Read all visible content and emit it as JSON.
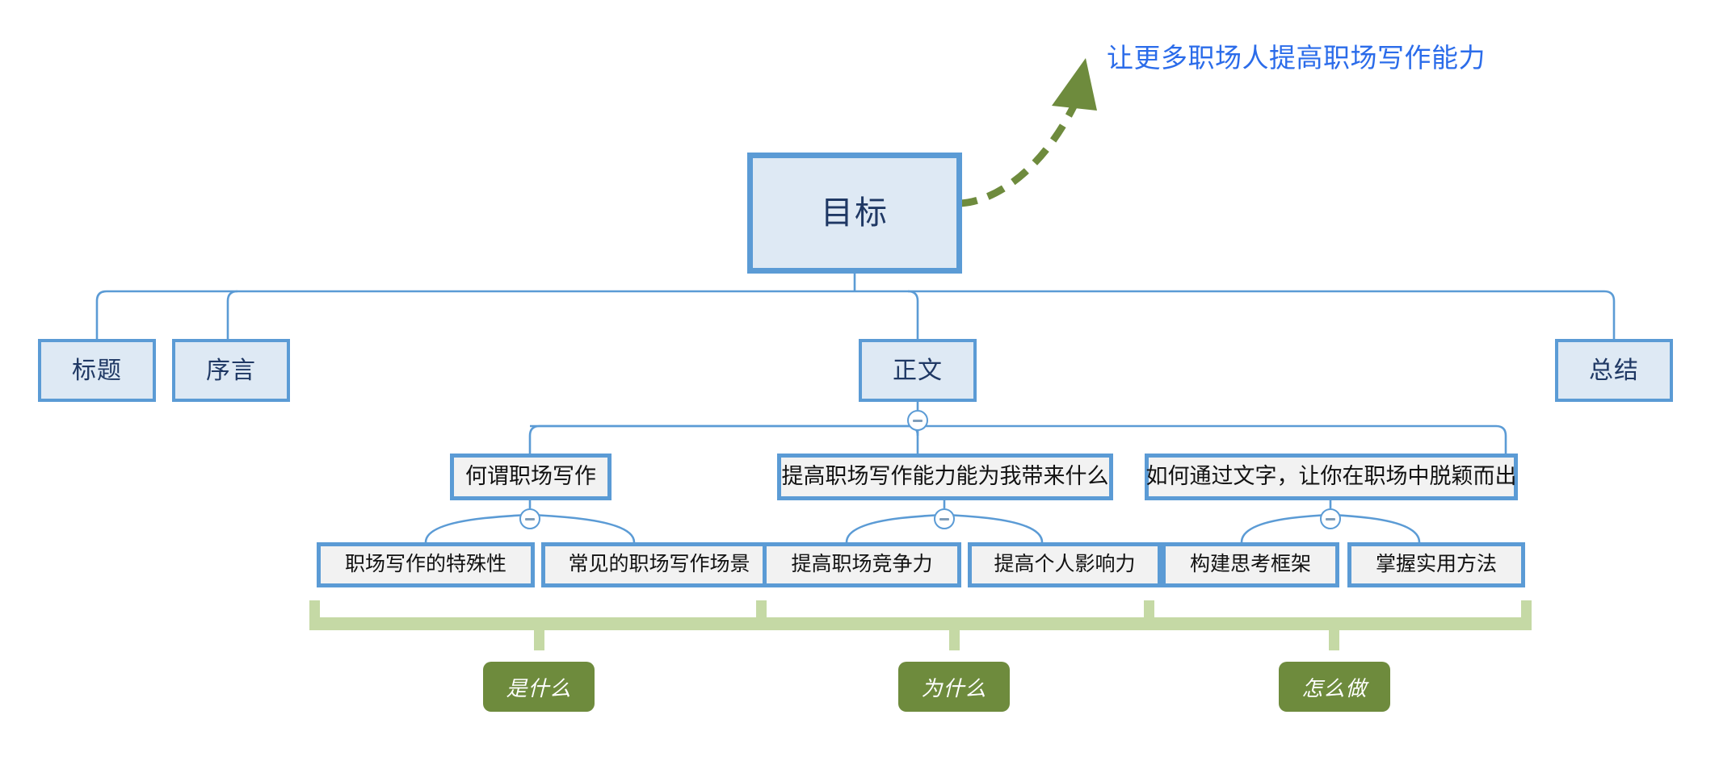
{
  "diagram": {
    "title_annotation": "让更多职场人提高职场写作能力",
    "colors": {
      "node_border": "#5B9BD5",
      "node_fill_blue": "#DEE9F4",
      "node_fill_gray": "#F2F2F2",
      "node_text": "#1F3864",
      "connector": "#5B9BD5",
      "bracket_green": "#C5D9A5",
      "pill_green": "#6E8B3D",
      "annotation_blue": "#2B6CEA",
      "arrow_green": "#6E8B3D"
    },
    "root": {
      "label": "目标"
    },
    "level2": [
      {
        "label": "标题"
      },
      {
        "label": "序言"
      },
      {
        "label": "正文"
      },
      {
        "label": "总结"
      }
    ],
    "level3": [
      {
        "label": "何谓职场写作"
      },
      {
        "label": "提高职场写作能力能为我带来什么"
      },
      {
        "label": "如何通过文字，让你在职场中脱颖而出"
      }
    ],
    "level4": [
      {
        "label": "职场写作的特殊性"
      },
      {
        "label": "常见的职场写作场景"
      },
      {
        "label": "提高职场竞争力"
      },
      {
        "label": "提高个人影响力"
      },
      {
        "label": "构建思考框架"
      },
      {
        "label": "掌握实用方法"
      }
    ],
    "bracket_labels": [
      {
        "label": "是什么"
      },
      {
        "label": "为什么"
      },
      {
        "label": "怎么做"
      }
    ],
    "toggles": [
      {
        "state": "minus",
        "owner": "正文"
      },
      {
        "state": "minus",
        "owner": "何谓职场写作"
      },
      {
        "state": "minus",
        "owner": "提高职场写作能力能为我带来什么"
      },
      {
        "state": "minus",
        "owner": "如何通过文字，让你在职场中脱颖而出"
      }
    ]
  }
}
